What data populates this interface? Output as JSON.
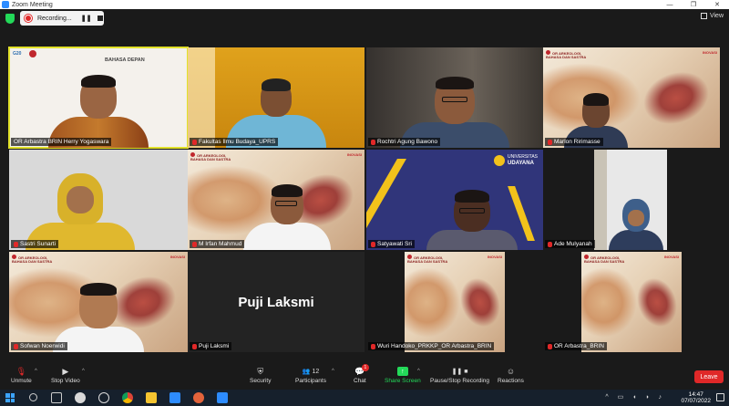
{
  "window": {
    "title": "Zoom Meeting",
    "minimize": "—",
    "restore": "❐",
    "close": "✕"
  },
  "recording": {
    "label": "Recording...",
    "pause_icon": "pause-icon",
    "stop_icon": "stop-icon"
  },
  "view": {
    "label": "View"
  },
  "poster": {
    "brand_line1": "OR ARKEOLOGI,",
    "brand_line2": "BAHASA DAN SASTRA",
    "inovasi": "INOVASI"
  },
  "tiles": [
    {
      "name": "OR Arbastra BRIN Herry Yogaswara",
      "muted": false,
      "active": true
    },
    {
      "name": "Fakultas Ilmu Budaya_UPRS",
      "muted": true
    },
    {
      "name": "Rochtri Agung Bawono",
      "muted": true
    },
    {
      "name": "Marlon Ririmasse",
      "muted": true
    },
    {
      "name": "Sastri Sunarti",
      "muted": true
    },
    {
      "name": "M Irfan Mahmud",
      "muted": true
    },
    {
      "name": "Satyawati Sri",
      "muted": true
    },
    {
      "name": "Ade Mulyanah",
      "muted": true
    },
    {
      "name": "Sofwan Noerwidi",
      "muted": true
    },
    {
      "name": "Puji Laksmi",
      "muted": true,
      "big_name": "Puji Laksmi"
    },
    {
      "name": "Wuri Handoko_PRKKP_OR Arbastra_BRIN",
      "muted": true
    },
    {
      "name": "OR Arbastra_BRIN",
      "muted": true
    }
  ],
  "tile1_banner": "BAHASA DEPAN",
  "udayana": {
    "line1": "UNIVERSITAS",
    "line2": "UDAYANA"
  },
  "toolbar": {
    "unmute": "Unmute",
    "stop_video": "Stop Video",
    "security": "Security",
    "participants": "Participants",
    "participants_count": "12",
    "chat": "Chat",
    "chat_badge": "1",
    "share_screen": "Share Screen",
    "pause_stop_recording": "Pause/Stop Recording",
    "reactions": "Reactions",
    "leave": "Leave"
  },
  "taskbar": {
    "time": "14:47",
    "date": "07/07/2022"
  },
  "colors": {
    "accent_green": "#23d959",
    "leave_red": "#e02828",
    "active_speaker": "#e2e22a",
    "zoom_blue": "#2d8cff"
  }
}
